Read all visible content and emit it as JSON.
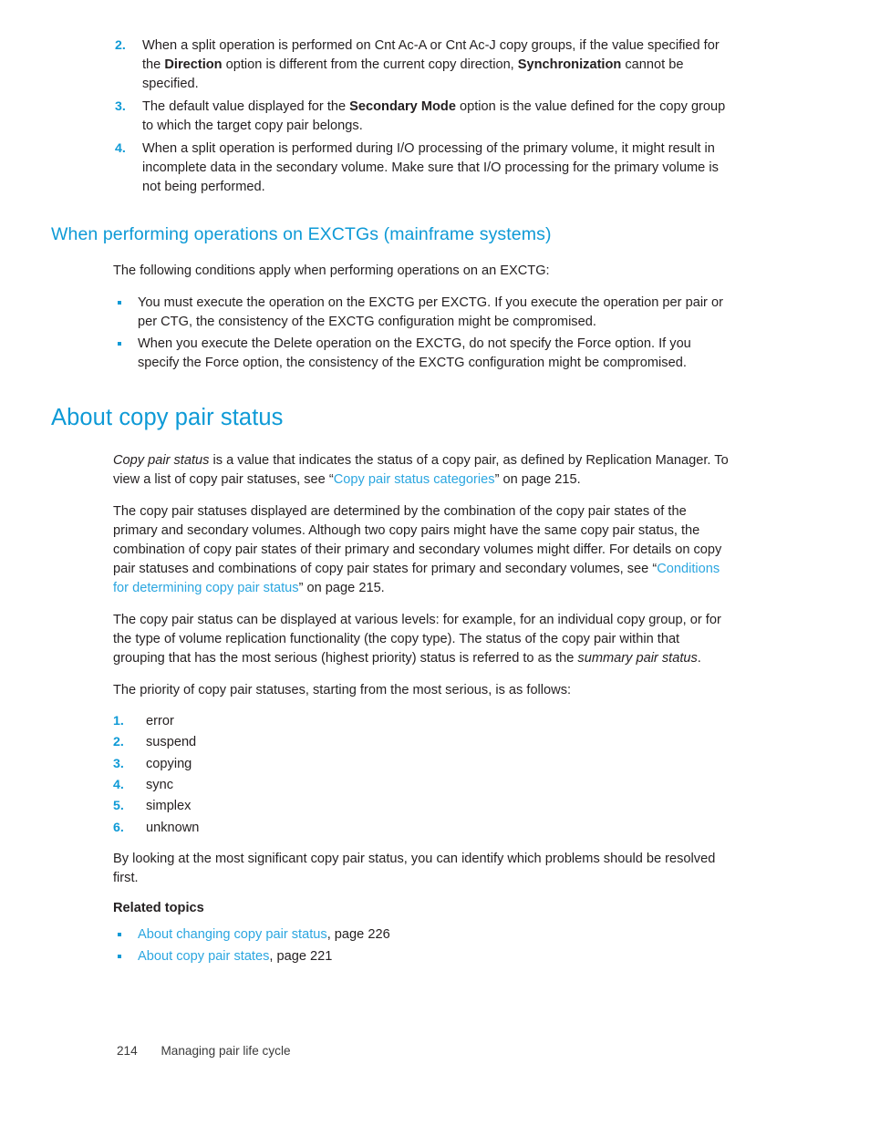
{
  "document": {
    "notes": [
      {
        "number": "2.",
        "segments": [
          {
            "text": "When a split operation is performed on Cnt Ac-A or Cnt Ac-J copy groups, if the value specified for the ",
            "style": "normal"
          },
          {
            "text": "Direction",
            "style": "bold"
          },
          {
            "text": " option is different from the current copy direction, ",
            "style": "normal"
          },
          {
            "text": "Synchronization",
            "style": "bold"
          },
          {
            "text": " cannot be specified.",
            "style": "normal"
          }
        ]
      },
      {
        "number": "3.",
        "segments": [
          {
            "text": "The default value displayed for the ",
            "style": "normal"
          },
          {
            "text": "Secondary Mode",
            "style": "bold"
          },
          {
            "text": " option is the value defined for the copy group to which the target copy pair belongs.",
            "style": "normal"
          }
        ]
      },
      {
        "number": "4.",
        "segments": [
          {
            "text": "When a split operation is performed during I/O processing of the primary volume, it might result in incomplete data in the secondary volume. Make sure that I/O processing for the primary volume is not being performed.",
            "style": "normal"
          }
        ]
      }
    ],
    "section_exctg": {
      "heading": "When performing operations on EXCTGs (mainframe systems)",
      "intro": "The following conditions apply when performing operations on an EXCTG:",
      "bullets": [
        "You must execute the operation on the EXCTG per EXCTG. If you execute the operation per pair or per CTG, the consistency of the EXCTG configuration might be compromised.",
        "When you execute the Delete operation on the EXCTG, do not specify the Force option. If you specify the Force option, the consistency of the EXCTG configuration might be compromised."
      ]
    },
    "section_status": {
      "heading": "About copy pair status",
      "para1": [
        {
          "text": "Copy pair status",
          "style": "italic"
        },
        {
          "text": " is a value that indicates the status of a copy pair, as defined by Replication Manager. To view a list of copy pair statuses, see “",
          "style": "normal"
        },
        {
          "text": "Copy pair status categories",
          "style": "link"
        },
        {
          "text": "” on page 215.",
          "style": "normal"
        }
      ],
      "para2": [
        {
          "text": "The copy pair statuses displayed are determined by the combination of the copy pair states of the primary and secondary volumes. Although two copy pairs might have the same copy pair status, the combination of copy pair states of their primary and secondary volumes might differ. For details on copy pair statuses and combinations of copy pair states for primary and secondary volumes, see “",
          "style": "normal"
        },
        {
          "text": "Conditions for determining copy pair status",
          "style": "link"
        },
        {
          "text": "” on page 215.",
          "style": "normal"
        }
      ],
      "para3": [
        {
          "text": "The copy pair status can be displayed at various levels: for example, for an individual copy group, or for the type of volume replication functionality (the copy type). The status of the copy pair within that grouping that has the most serious (highest priority) status is referred to as the ",
          "style": "normal"
        },
        {
          "text": "summary pair status",
          "style": "italic"
        },
        {
          "text": ".",
          "style": "normal"
        }
      ],
      "para4": "The priority of copy pair statuses, starting from the most serious, is as follows:",
      "priority_items": [
        {
          "number": "1.",
          "label": "error"
        },
        {
          "number": "2.",
          "label": "suspend"
        },
        {
          "number": "3.",
          "label": "copying"
        },
        {
          "number": "4.",
          "label": "sync"
        },
        {
          "number": "5.",
          "label": "simplex"
        },
        {
          "number": "6.",
          "label": "unknown"
        }
      ],
      "para5": "By looking at the most significant copy pair status, you can identify which problems should be resolved first.",
      "related_heading": "Related topics",
      "related_links": [
        {
          "link": "About changing copy pair status",
          "suffix": ", page 226"
        },
        {
          "link": "About copy pair states",
          "suffix": ", page 221"
        }
      ]
    },
    "footer": {
      "page_number": "214",
      "chapter": "Managing pair life cycle"
    },
    "colors": {
      "heading_blue": "#0e9ad6",
      "link_blue": "#2ba6e0",
      "body_text": "#231f20"
    }
  }
}
